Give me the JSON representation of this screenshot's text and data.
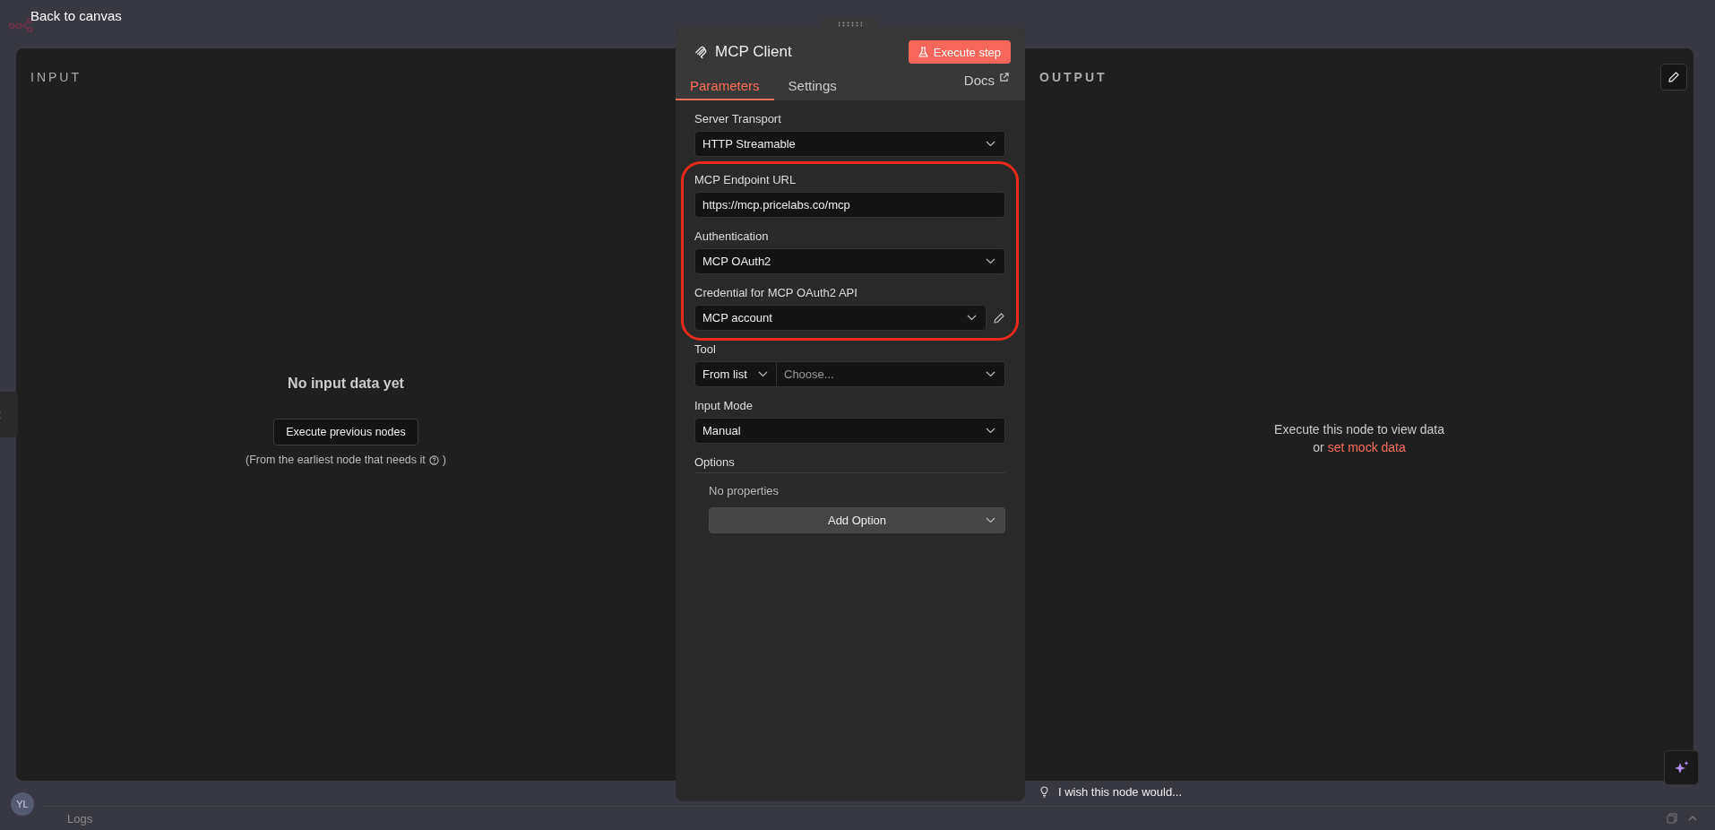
{
  "top_bar": {
    "back_link": "Back to canvas"
  },
  "input_pane": {
    "heading": "INPUT",
    "empty_title": "No input data yet",
    "button": "Execute previous nodes",
    "hint_before": "(From the earliest node that needs it",
    "hint_after": ")"
  },
  "node_panel": {
    "title": "MCP Client",
    "execute_button": "Execute step",
    "tabs": [
      {
        "label": "Parameters",
        "selected": true
      },
      {
        "label": "Settings",
        "selected": false
      }
    ],
    "docs_link": "Docs",
    "groups": [
      {
        "highlighted": false,
        "fields": [
          {
            "kind": "select",
            "label": "Server Transport",
            "value": "HTTP Streamable"
          }
        ]
      },
      {
        "highlighted": true,
        "fields": [
          {
            "kind": "text",
            "label": "MCP Endpoint URL",
            "value": "https://mcp.pricelabs.co/mcp"
          },
          {
            "kind": "select",
            "label": "Authentication",
            "value": "MCP OAuth2"
          },
          {
            "kind": "credential",
            "label": "Credential for MCP OAuth2 API",
            "value": "MCP account"
          }
        ]
      },
      {
        "highlighted": false,
        "fields": [
          {
            "kind": "split-select",
            "label": "Tool",
            "mode": "From list",
            "placeholder": "Choose..."
          },
          {
            "kind": "select",
            "label": "Input Mode",
            "value": "Manual"
          }
        ]
      }
    ],
    "options": {
      "label": "Options",
      "empty_text": "No properties",
      "add_button": "Add Option"
    }
  },
  "output_pane": {
    "heading": "OUTPUT",
    "message": "Execute this node to view data",
    "alt_prefix": "or",
    "mock_link": "set mock data"
  },
  "feedback": {
    "prompt": "I wish this node would..."
  },
  "logs_bar": {
    "avatar_initials": "YL",
    "label": "Logs"
  }
}
